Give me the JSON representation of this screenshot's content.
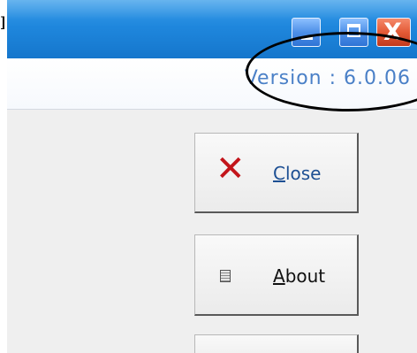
{
  "left_edge_text": "I",
  "window": {
    "controls": {
      "minimize_icon": "minimize-icon",
      "maximize_icon": "maximize-icon",
      "close_icon": "close-icon",
      "close_glyph": "X"
    },
    "version": {
      "text": "Version : 6.0.06"
    },
    "buttons": {
      "close": {
        "access_key": "C",
        "label_rest": "lose",
        "icon": "close-x-icon",
        "glyph": "✕"
      },
      "about": {
        "access_key": "A",
        "label_rest": "bout",
        "icon": "document-icon"
      }
    }
  },
  "colors": {
    "title_bar": "#1f87dd",
    "version_text": "#4a80c7",
    "close_icon": "#c3151b",
    "button_border_dark": "#595959"
  }
}
